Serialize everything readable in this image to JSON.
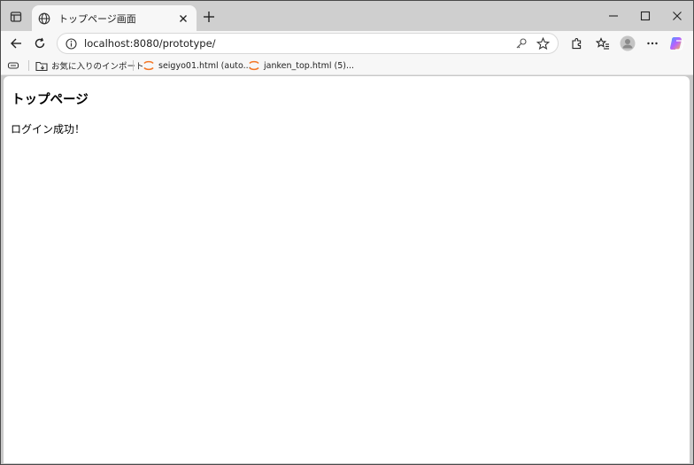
{
  "browser": {
    "tab": {
      "title": "トップページ画面"
    },
    "address_bar": {
      "url": "localhost:8080/prototype/"
    },
    "bookmarks": [
      {
        "label": "お気に入りのインポート",
        "icon": "folder-import-icon"
      },
      {
        "label": "seigyo01.html (auto...",
        "icon": "jupyter-icon"
      },
      {
        "label": "janken_top.html (5)...",
        "icon": "jupyter-icon"
      }
    ]
  },
  "page": {
    "heading": "トップページ",
    "message": "ログイン成功！"
  },
  "colors": {
    "tabstrip": "#cfcfcf",
    "toolbar": "#f7f7f7",
    "jupyter_orange": "#f37726",
    "copilot_gradient": [
      "#3fa0ff",
      "#b760ff",
      "#ffb44a"
    ]
  }
}
